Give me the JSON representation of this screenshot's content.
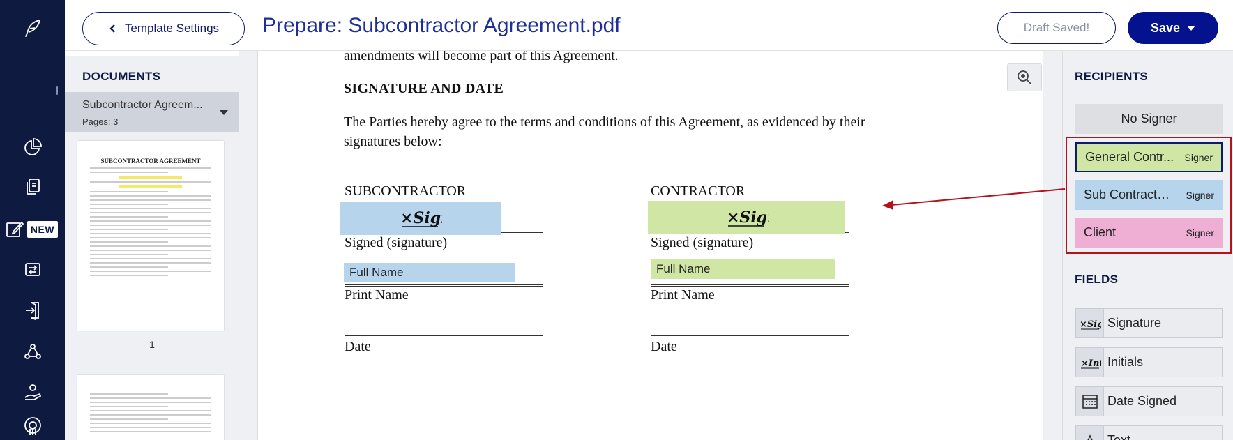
{
  "header": {
    "back_label": "Template Settings",
    "doc_title": "Prepare: Subcontractor Agreement.pdf",
    "draft_label": "Draft Saved!",
    "save_label": "Save"
  },
  "nav": {
    "new_badge": "NEW",
    "icons": [
      "feather-logo-icon",
      "pie-chart-icon",
      "documents-icon",
      "edit-icon",
      "transfer-icon",
      "exit-door-icon",
      "network-icon",
      "hand-icon",
      "lifebuoy-icon"
    ]
  },
  "documents": {
    "heading": "DOCUMENTS",
    "item_name": "Subcontractor Agreem...",
    "item_pages": "Pages: 3",
    "thumb_title": "SUBCONTRACTOR AGREEMENT",
    "page_number": "1"
  },
  "page": {
    "top_line": "amendments will become part of this Agreement.",
    "heading": "SIGNATURE AND DATE",
    "body_line1": "The Parties hereby agree to the terms and conditions of this Agreement, as evidenced by their",
    "body_line2": "signatures below:",
    "sub_heading": "SUBCONTRACTOR",
    "contractor_heading": "CONTRACTOR",
    "signed_label": "Signed (signature)",
    "print_name_label": "Print Name",
    "date_label": "Date",
    "full_name_field": "Full Name"
  },
  "recipients": {
    "heading": "RECIPIENTS",
    "no_signer": "No Signer",
    "list": [
      {
        "name": "General Contr...",
        "role": "Signer",
        "color": "#cfe6a5"
      },
      {
        "name": "Sub Contractore",
        "role": "Signer",
        "color": "#b6d4eb"
      },
      {
        "name": "Client",
        "role": "Signer",
        "color": "#efafd4"
      }
    ]
  },
  "fields": {
    "heading": "FIELDS",
    "list": [
      {
        "label": "Signature",
        "icon": "signature-icon"
      },
      {
        "label": "Initials",
        "icon": "initials-icon"
      },
      {
        "label": "Date Signed",
        "icon": "calendar-icon"
      },
      {
        "label": "Text",
        "icon": "text-icon"
      }
    ]
  },
  "colors": {
    "nav_bg": "#0e1a40",
    "primary": "#05128e",
    "highlight_border": "#b5121b",
    "sub_blue": "#b6d4eb",
    "gc_green": "#cfe6a5",
    "client_pink": "#efafd4"
  }
}
